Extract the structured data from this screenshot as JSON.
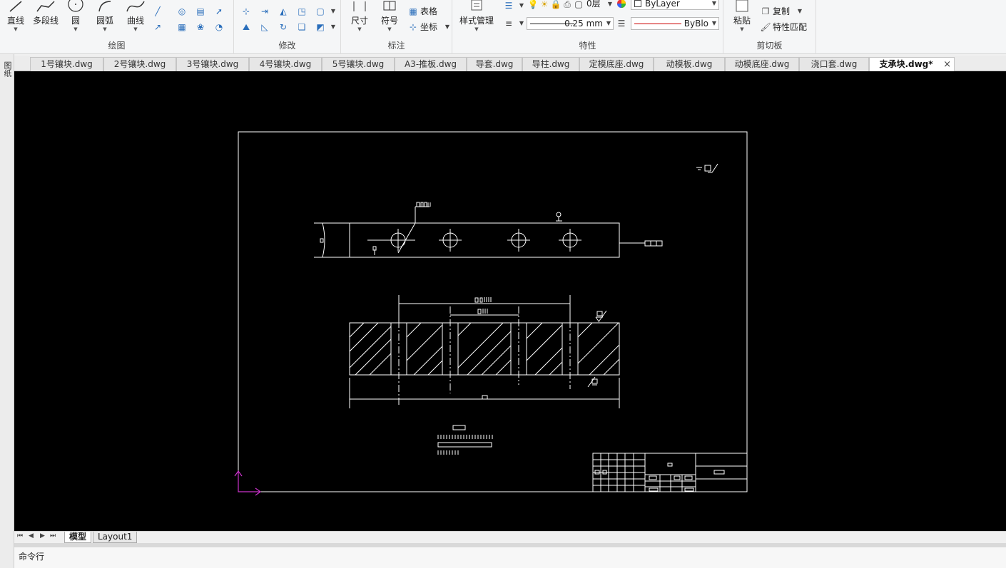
{
  "ribbon": {
    "draw": {
      "label": "绘图",
      "line": "直线",
      "polyline": "多段线",
      "circle": "圆",
      "arc": "圆弧",
      "curve": "曲线"
    },
    "modify": {
      "label": "修改"
    },
    "annotate": {
      "label": "标注",
      "dimension": "尺寸",
      "symbol": "符号",
      "table": "表格",
      "coordinate": "坐标"
    },
    "properties": {
      "label": "特性",
      "style_manager": "样式管理",
      "layer_value": "0层",
      "color_value": "ByLayer",
      "lineweight_value": "0.25 mm",
      "linetype_value": "ByBlo"
    },
    "clipboard": {
      "label": "剪切板",
      "paste": "粘贴",
      "copy": "复制",
      "match_properties": "特性匹配"
    }
  },
  "left_strip": {
    "text": "图纸"
  },
  "tabs": [
    {
      "label": "1号镶块.dwg"
    },
    {
      "label": "2号镶块.dwg"
    },
    {
      "label": "3号镶块.dwg"
    },
    {
      "label": "4号镶块.dwg"
    },
    {
      "label": "5号镶块.dwg"
    },
    {
      "label": "A3-推板.dwg"
    },
    {
      "label": "导套.dwg"
    },
    {
      "label": "导柱.dwg"
    },
    {
      "label": "定模底座.dwg"
    },
    {
      "label": "动模板.dwg"
    },
    {
      "label": "动模底座.dwg"
    },
    {
      "label": "浇口套.dwg"
    },
    {
      "label": "支承块.dwg*",
      "active": true
    }
  ],
  "tab_close": "×",
  "layout_tabs": {
    "model": "模型",
    "layout1": "Layout1"
  },
  "nav_buttons": {
    "first": "⏮",
    "prev": "◀",
    "next": "▶",
    "last": "⏭"
  },
  "command_line": {
    "label": "命令行"
  },
  "colors": {
    "canvas": "#000000",
    "drawing": "#ffffff",
    "ucs": "#cc33cc",
    "linetype_swatch": "#cc0000"
  }
}
